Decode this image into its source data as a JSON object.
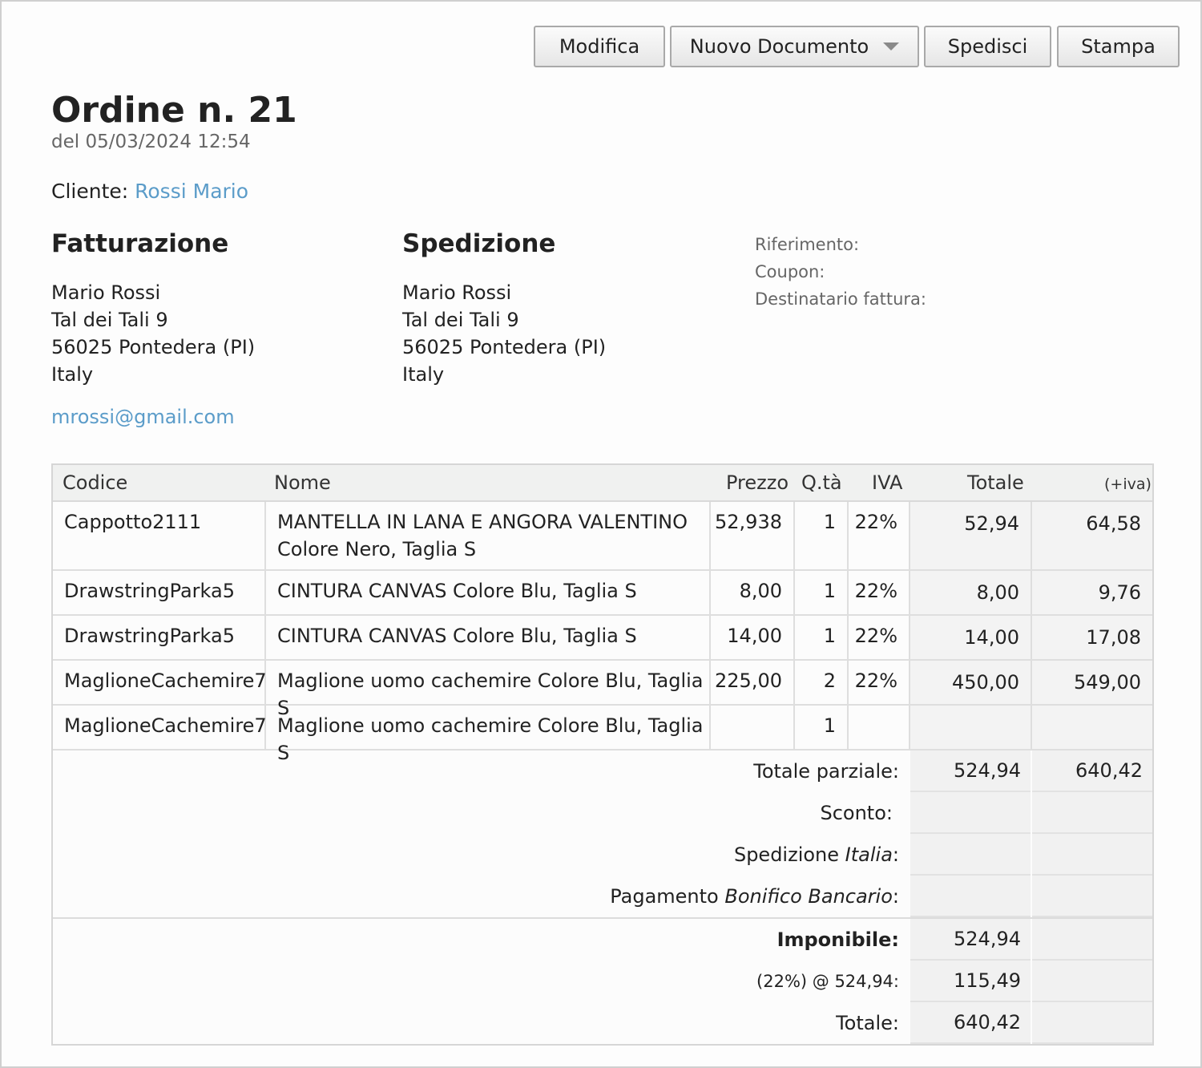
{
  "toolbar": {
    "edit_label": "Modifica",
    "new_doc_label": "Nuovo Documento",
    "send_label": "Spedisci",
    "print_label": "Stampa"
  },
  "order": {
    "title": "Ordine n. 21",
    "date": "del 05/03/2024 12:54",
    "client_label": "Cliente:",
    "client_name": "Rossi Mario"
  },
  "billing": {
    "heading": "Fatturazione",
    "lines": [
      "Mario Rossi",
      "Tal dei Tali 9",
      "56025 Pontedera (PI)",
      "Italy"
    ],
    "email": "mrossi@gmail.com"
  },
  "shipping": {
    "heading": "Spedizione",
    "lines": [
      "Mario Rossi",
      "Tal dei Tali 9",
      "56025 Pontedera (PI)",
      "Italy"
    ]
  },
  "meta": {
    "reference_label": "Riferimento:",
    "coupon_label": "Coupon:",
    "invoice_recipient_label": "Destinatario fattura:"
  },
  "table": {
    "headers": {
      "code": "Codice",
      "name": "Nome",
      "price": "Prezzo",
      "qty": "Q.tà",
      "vat": "IVA",
      "total": "Totale",
      "total_vat": "(+iva)"
    },
    "rows": [
      {
        "code": "Cappotto2111",
        "name_line1": "MANTELLA IN LANA E ANGORA VALENTINO",
        "name_line2": "Colore Nero, Taglia S",
        "price": "52,938",
        "qty": "1",
        "vat": "22%",
        "total": "52,94",
        "total_vat": "64,58"
      },
      {
        "code": "DrawstringParka5",
        "name_line1": "CINTURA CANVAS Colore Blu, Taglia S",
        "name_line2": "",
        "price": "8,00",
        "qty": "1",
        "vat": "22%",
        "total": "8,00",
        "total_vat": "9,76"
      },
      {
        "code": "DrawstringParka5",
        "name_line1": "CINTURA CANVAS Colore Blu, Taglia S",
        "name_line2": "",
        "price": "14,00",
        "qty": "1",
        "vat": "22%",
        "total": "14,00",
        "total_vat": "17,08"
      },
      {
        "code": "MaglioneCachemire7",
        "name_line1": "Maglione uomo cachemire Colore Blu, Taglia S",
        "name_line2": "",
        "price": "225,00",
        "qty": "2",
        "vat": "22%",
        "total": "450,00",
        "total_vat": "549,00"
      },
      {
        "code": "MaglioneCachemire7",
        "name_line1": "Maglione uomo cachemire Colore Blu, Taglia S",
        "name_line2": "",
        "price": "",
        "qty": "1",
        "vat": "",
        "total": "",
        "total_vat": ""
      }
    ],
    "summary": {
      "subtotal_label": "Totale parziale:",
      "subtotal": "524,94",
      "subtotal_vat": "640,42",
      "discount_label": "Sconto:",
      "shipping_label_prefix": "Spedizione ",
      "shipping_label_method": "Italia",
      "shipping_label_suffix": ":",
      "payment_label_prefix": "Pagamento ",
      "payment_label_method": "Bonifico Bancario",
      "payment_label_suffix": ":",
      "taxable_label": "Imponibile:",
      "taxable": "524,94",
      "vat_label": "(22%) @ 524,94:",
      "vat": "115,49",
      "total_label": "Totale:",
      "total": "640,42"
    }
  }
}
